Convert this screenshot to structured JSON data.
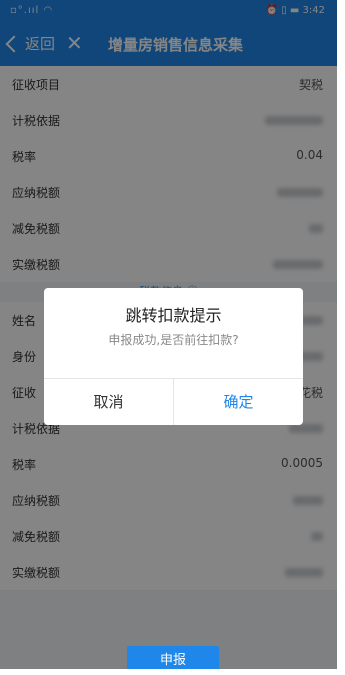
{
  "statusbar": {
    "left": "▫°.ııl ◠",
    "right": "⏰ ▯ ▬ 3:42"
  },
  "nav": {
    "back_label": "返回",
    "close_glyph": "✕",
    "title": "增量房销售信息采集"
  },
  "section1": [
    {
      "label": "征收项目",
      "value": "契税"
    },
    {
      "label": "计税依据",
      "value": null,
      "blurred": true
    },
    {
      "label": "税率",
      "value": "0.04"
    },
    {
      "label": "应纳税额",
      "value": null,
      "blurred": true
    },
    {
      "label": "减免税额",
      "value": null,
      "blurred": true
    },
    {
      "label": "实缴税额",
      "value": null,
      "blurred": true
    }
  ],
  "section_link": "税款信息 ⓘ",
  "section2": [
    {
      "label": "姓名",
      "value": null,
      "blurred": true
    },
    {
      "label": "身份",
      "value": null,
      "blurred": true
    },
    {
      "label": "征收",
      "value": "花税"
    },
    {
      "label": "计税依据",
      "value": null,
      "blurred": true
    },
    {
      "label": "税率",
      "value": "0.0005"
    },
    {
      "label": "应纳税额",
      "value": null,
      "blurred": true
    },
    {
      "label": "减免税额",
      "value": null,
      "blurred": true
    },
    {
      "label": "实缴税额",
      "value": null,
      "blurred": true
    }
  ],
  "dialog": {
    "title": "跳转扣款提示",
    "message": "申报成功,是否前往扣款?",
    "cancel": "取消",
    "confirm": "确定"
  },
  "submit_label": "申报",
  "colors": {
    "primary": "#1f86ea",
    "overlay": "rgba(0,0,0,0.48)"
  }
}
